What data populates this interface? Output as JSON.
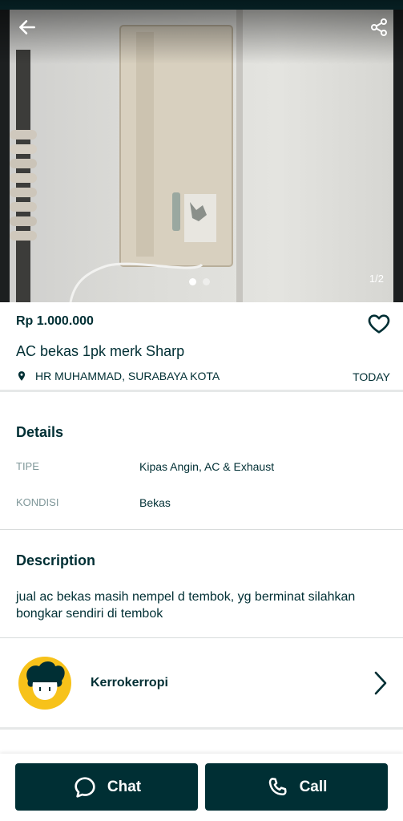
{
  "gallery": {
    "counter": "1/2",
    "current": 1,
    "total": 2
  },
  "listing": {
    "price": "Rp 1.000.000",
    "title": "AC bekas 1pk merk Sharp",
    "location": "HR MUHAMMAD, SURABAYA KOTA",
    "date": "TODAY"
  },
  "details": {
    "heading": "Details",
    "rows": [
      {
        "label": "TIPE",
        "value": "Kipas Angin, AC & Exhaust"
      },
      {
        "label": "KONDISI",
        "value": "Bekas"
      }
    ]
  },
  "description": {
    "heading": "Description",
    "text": "jual ac bekas masih nempel d tembok, yg berminat silahkan bongkar sendiri di tembok"
  },
  "seller": {
    "name": "Kerrokerropi"
  },
  "actions": {
    "chat_label": "Chat",
    "call_label": "Call"
  },
  "icons": {
    "back": "arrow-left-icon",
    "share": "share-icon",
    "favorite": "heart-icon",
    "location": "location-pin-icon",
    "chevron": "chevron-right-icon",
    "chat": "chat-bubble-icon",
    "call": "phone-icon"
  },
  "colors": {
    "primary": "#002f34",
    "avatar_bg": "#f7c21a"
  }
}
